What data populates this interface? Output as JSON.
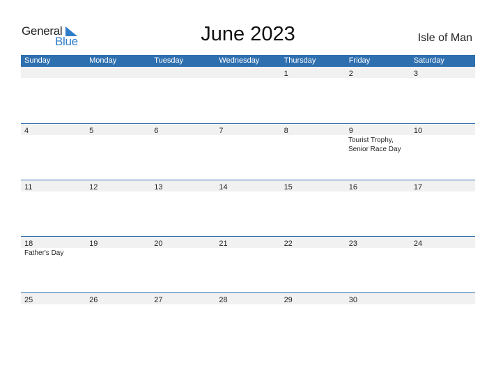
{
  "brand": {
    "word1": "General",
    "word2": "Blue",
    "accent": "#2f7dc9"
  },
  "title": "June 2023",
  "country": "Isle of Man",
  "colors": {
    "header_bg": "#2e6faf",
    "strip_bg": "#f1f1f1"
  },
  "weekdays": [
    "Sunday",
    "Monday",
    "Tuesday",
    "Wednesday",
    "Thursday",
    "Friday",
    "Saturday"
  ],
  "weeks": [
    {
      "days": [
        "",
        "",
        "",
        "",
        "1",
        "2",
        "3"
      ],
      "events": [
        "",
        "",
        "",
        "",
        "",
        "",
        ""
      ]
    },
    {
      "days": [
        "4",
        "5",
        "6",
        "7",
        "8",
        "9",
        "10"
      ],
      "events": [
        "",
        "",
        "",
        "",
        "",
        "Tourist Trophy, Senior Race Day",
        ""
      ]
    },
    {
      "days": [
        "11",
        "12",
        "13",
        "14",
        "15",
        "16",
        "17"
      ],
      "events": [
        "",
        "",
        "",
        "",
        "",
        "",
        ""
      ]
    },
    {
      "days": [
        "18",
        "19",
        "20",
        "21",
        "22",
        "23",
        "24"
      ],
      "events": [
        "Father's Day",
        "",
        "",
        "",
        "",
        "",
        ""
      ]
    },
    {
      "days": [
        "25",
        "26",
        "27",
        "28",
        "29",
        "30",
        ""
      ],
      "events": [
        "",
        "",
        "",
        "",
        "",
        "",
        ""
      ]
    }
  ]
}
